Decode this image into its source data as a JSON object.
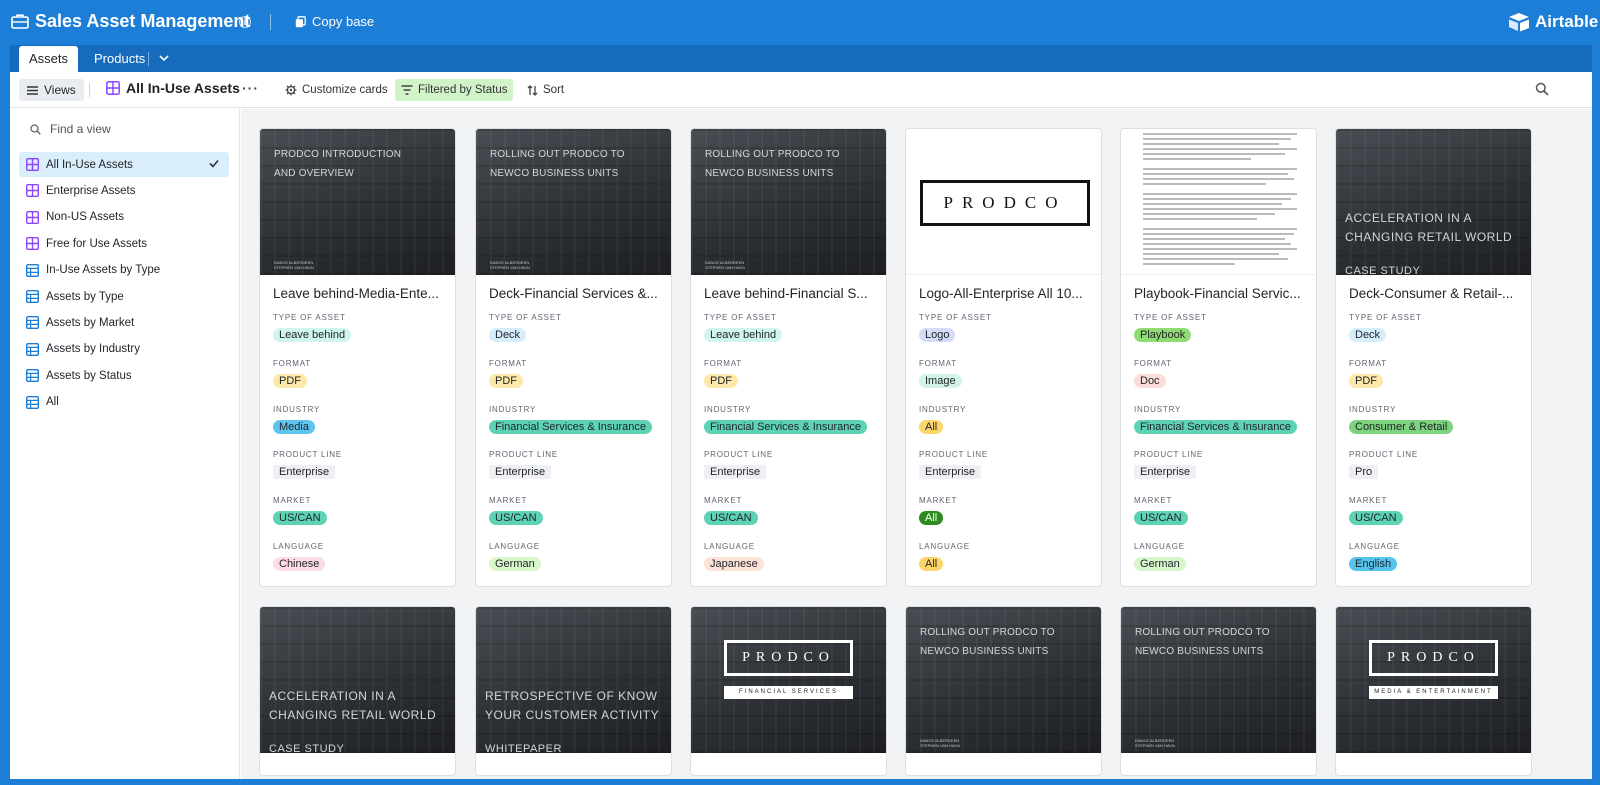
{
  "app": {
    "title": "Sales Asset Management",
    "copy_base": "Copy base",
    "brand": "Airtable"
  },
  "tabs": [
    {
      "label": "Assets",
      "active": true
    },
    {
      "label": "Products",
      "active": false
    }
  ],
  "toolbar": {
    "views": "Views",
    "current_view": "All In-Use Assets",
    "more": "···",
    "customize": "Customize cards",
    "filter": "Filtered by Status",
    "sort": "Sort"
  },
  "sidebar": {
    "search_placeholder": "Find a view",
    "views": [
      {
        "label": "All In-Use Assets",
        "type": "gallery",
        "active": true
      },
      {
        "label": "Enterprise Assets",
        "type": "gallery",
        "active": false
      },
      {
        "label": "Non-US Assets",
        "type": "gallery",
        "active": false
      },
      {
        "label": "Free for Use Assets",
        "type": "gallery",
        "active": false
      },
      {
        "label": "In-Use Assets by Type",
        "type": "grid",
        "active": false
      },
      {
        "label": "Assets by Type",
        "type": "grid",
        "active": false
      },
      {
        "label": "Assets by Market",
        "type": "grid",
        "active": false
      },
      {
        "label": "Assets by Industry",
        "type": "grid",
        "active": false
      },
      {
        "label": "Assets by Status",
        "type": "grid",
        "active": false
      },
      {
        "label": "All",
        "type": "grid",
        "active": false
      }
    ]
  },
  "field_labels": {
    "type": "TYPE OF ASSET",
    "format": "FORMAT",
    "industry": "INDUSTRY",
    "product_line": "PRODUCT LINE",
    "market": "MARKET",
    "language": "LANGUAGE"
  },
  "colors": {
    "topbar": "#1c7ed6",
    "tag_leave_behind": "#d0f5ec",
    "tag_deck": "#d6eefb",
    "tag_logo": "#d4dcf7",
    "tag_playbook": "#8fdc72",
    "tag_pdf": "#fde9a9",
    "tag_image": "#d3f3e6",
    "tag_doc": "#fcdcd8",
    "tag_media": "#5fc4ee",
    "tag_fsi": "#5ed3b4",
    "tag_all_industry": "#fdd66b",
    "tag_consumer": "#7dd37e",
    "tag_uscan": "#5ed3b4",
    "tag_all_market": "#2e8b1f",
    "tag_chinese": "#fcdce5",
    "tag_german": "#d9f5cb",
    "tag_japanese": "#fde2d8",
    "tag_english": "#56c5ee",
    "filter_bg": "#d1f3c8"
  },
  "cards": [
    {
      "thumb": {
        "kind": "building",
        "text": "PRODCO INTRODUCTION AND OVERVIEW",
        "names": "DANCE ALBERDEEN\nSTEPHEN VAN HAVN"
      },
      "title": "Leave behind-Media-Ente...",
      "type": "Leave behind",
      "format": "PDF",
      "industry": "Media",
      "product_line": "Enterprise",
      "market": "US/CAN",
      "language": "Chinese"
    },
    {
      "thumb": {
        "kind": "building",
        "text": "ROLLING OUT PRODCO TO NEWCO BUSINESS UNITS",
        "names": "DANCE ALBERDEEN\nSTEPHEN VAN HAVN"
      },
      "title": "Deck-Financial Services &...",
      "type": "Deck",
      "format": "PDF",
      "industry": "Financial Services & Insurance",
      "product_line": "Enterprise",
      "market": "US/CAN",
      "language": "German"
    },
    {
      "thumb": {
        "kind": "building",
        "text": "ROLLING OUT PRODCO TO NEWCO BUSINESS UNITS",
        "names": "DANCE ALBERDEEN\nSTEPHEN VAN HAVN"
      },
      "title": "Leave behind-Financial S...",
      "type": "Leave behind",
      "format": "PDF",
      "industry": "Financial Services & Insurance",
      "product_line": "Enterprise",
      "market": "US/CAN",
      "language": "Japanese"
    },
    {
      "thumb": {
        "kind": "logo",
        "text": "PRODCO"
      },
      "title": "Logo-All-Enterprise All 10...",
      "type": "Logo",
      "format": "Image",
      "industry": "All",
      "product_line": "Enterprise",
      "market": "All",
      "language": "All"
    },
    {
      "thumb": {
        "kind": "document"
      },
      "title": "Playbook-Financial Servic...",
      "type": "Playbook",
      "format": "Doc",
      "industry": "Financial Services & Insurance",
      "product_line": "Enterprise",
      "market": "US/CAN",
      "language": "German"
    },
    {
      "thumb": {
        "kind": "building-large",
        "text": "ACCELERATION IN A CHANGING RETAIL WORLD",
        "sub": "CASE STUDY"
      },
      "title": "Deck-Consumer & Retail-...",
      "type": "Deck",
      "format": "PDF",
      "industry": "Consumer & Retail",
      "product_line": "Pro",
      "market": "US/CAN",
      "language": "English"
    },
    {
      "thumb": {
        "kind": "building-large",
        "text": "ACCELERATION IN A CHANGING RETAIL WORLD",
        "sub": "CASE STUDY"
      }
    },
    {
      "thumb": {
        "kind": "building-large",
        "text": "RETROSPECTIVE OF KNOW YOUR CUSTOMER ACTIVITY",
        "sub": "WHITEPAPER"
      }
    },
    {
      "thumb": {
        "kind": "logo-dark",
        "text": "PRODCO",
        "strip": "FINANCIAL SERVICES"
      }
    },
    {
      "thumb": {
        "kind": "building",
        "text": "ROLLING OUT PRODCO TO NEWCO BUSINESS UNITS",
        "names": "DANCE ALBERDEEN\nSTEPHEN VAN HAVN"
      }
    },
    {
      "thumb": {
        "kind": "building",
        "text": "ROLLING OUT PRODCO TO NEWCO BUSINESS UNITS",
        "names": "DANCE ALBERDEEN\nSTEPHEN VAN HAVN"
      }
    },
    {
      "thumb": {
        "kind": "logo-dark",
        "text": "PRODCO",
        "strip": "MEDIA & ENTERTAINMENT"
      }
    }
  ]
}
